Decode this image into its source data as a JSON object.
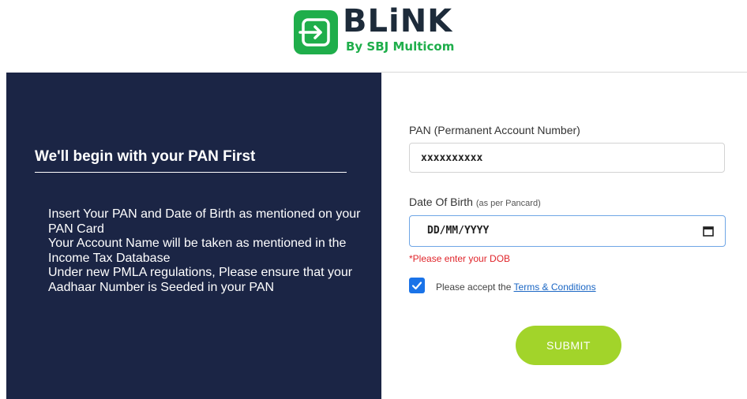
{
  "brand": {
    "name": "BLiNK",
    "tagline": "By SBJ Multicom",
    "logo_icon": "enter-arrow-icon",
    "primary_color": "#1fae4b"
  },
  "left_panel": {
    "title": "We'll begin with your PAN First",
    "instructions": [
      "Insert Your PAN and Date of Birth as mentioned on your PAN Card",
      "Your Account Name will be taken as mentioned in the Income Tax Database",
      "Under new PMLA regulations, Please ensure that your Aadhaar Number is Seeded in your PAN"
    ],
    "background_color": "#1b2545"
  },
  "form": {
    "pan": {
      "label": "PAN (Permanent Account Number)",
      "value": "xxxxxxxxxx"
    },
    "dob": {
      "label": "Date Of Birth",
      "hint": "(as per Pancard)",
      "value": "DD/MM/YYYY",
      "icon": "calendar-icon",
      "error": "*Please enter your DOB"
    },
    "consent": {
      "checked": true,
      "prefix": "Please accept the",
      "link": "Terms & Conditions"
    },
    "submit_label": "SUBMIT",
    "submit_color": "#a2d42a",
    "error_color": "#e0242a",
    "accent_color": "#1a73e8"
  }
}
